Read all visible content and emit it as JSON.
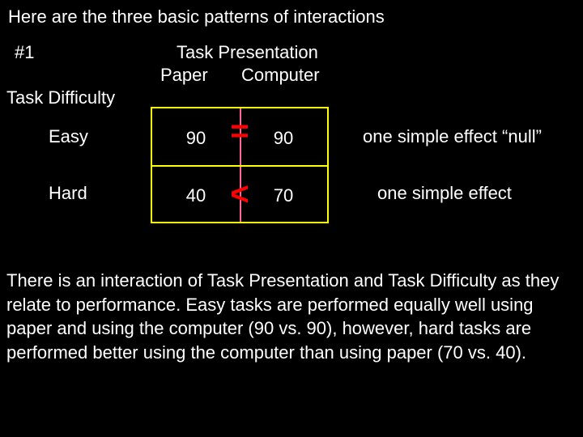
{
  "title": "Here are the three basic patterns of interactions",
  "pattern_number": "#1",
  "presentation": {
    "title": "Task Presentation",
    "col1": "Paper",
    "col2": "Computer"
  },
  "difficulty": {
    "title": "Task Difficulty",
    "row1": "Easy",
    "row2": "Hard"
  },
  "cells": {
    "easy_paper": "90",
    "easy_computer": "90",
    "hard_paper": "40",
    "hard_computer": "70",
    "op_easy": "=",
    "op_hard": "<"
  },
  "effects": {
    "easy": "one simple effect “null”",
    "hard": "one simple effect"
  },
  "summary": "There is an interaction of Task Presentation and Task Difficulty as they relate to performance.  Easy tasks are performed equally well using paper and using the computer (90 vs. 90), however, hard tasks are performed better using the computer than using paper (70 vs. 40)."
}
